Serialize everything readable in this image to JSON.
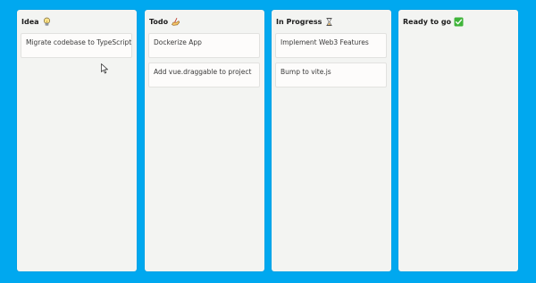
{
  "columns": [
    {
      "title": "Idea",
      "icon": "lightbulb-icon",
      "cards": [
        "Migrate codebase to TypeScript"
      ]
    },
    {
      "title": "Todo",
      "icon": "writing-hand-icon",
      "cards": [
        "Dockerize App",
        "Add vue.draggable to project"
      ]
    },
    {
      "title": "In Progress",
      "icon": "hourglass-icon",
      "cards": [
        "Implement Web3 Features",
        "Bump to vite.js"
      ]
    },
    {
      "title": "Ready to go",
      "icon": "check-mark-icon",
      "cards": []
    }
  ],
  "colors": {
    "background": "#00a8ef",
    "column": "#f3f4f2",
    "card": "#fdfcfb",
    "check": "#3fb43a"
  }
}
